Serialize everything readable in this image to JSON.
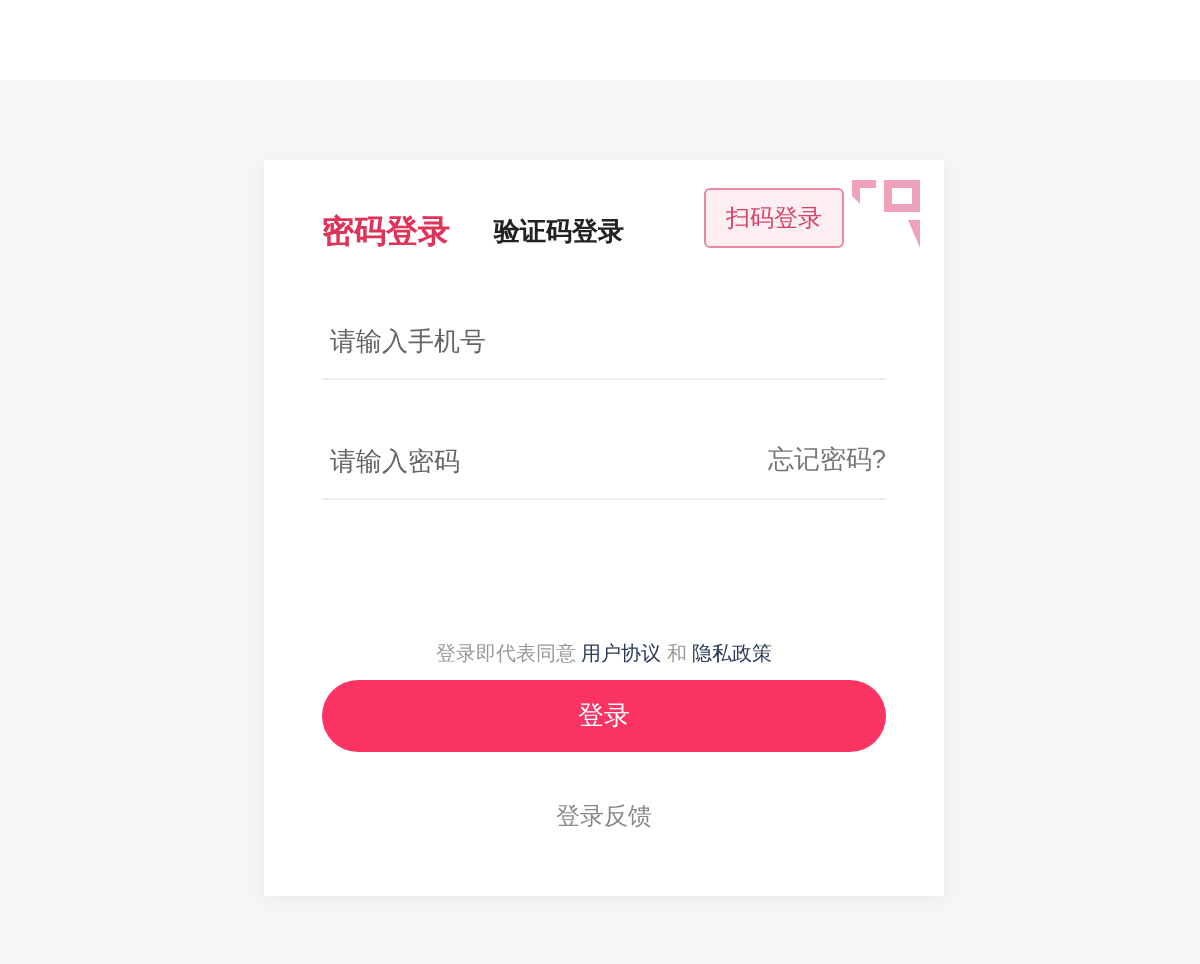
{
  "tabs": [
    {
      "label": "密码登录",
      "selected": true
    },
    {
      "label": "验证码登录",
      "selected": false
    }
  ],
  "qr_tip": "扫码登录",
  "fields": [
    {
      "placeholder": "请输入手机号"
    },
    {
      "placeholder": "请输入密码",
      "link": "忘记密码?"
    }
  ],
  "agreement": {
    "text": "登录即代表同意",
    "link1": "用户协议",
    "joiner": "和",
    "link2": "隐私政策"
  },
  "login_button": "登录",
  "feedback": "登录反馈"
}
